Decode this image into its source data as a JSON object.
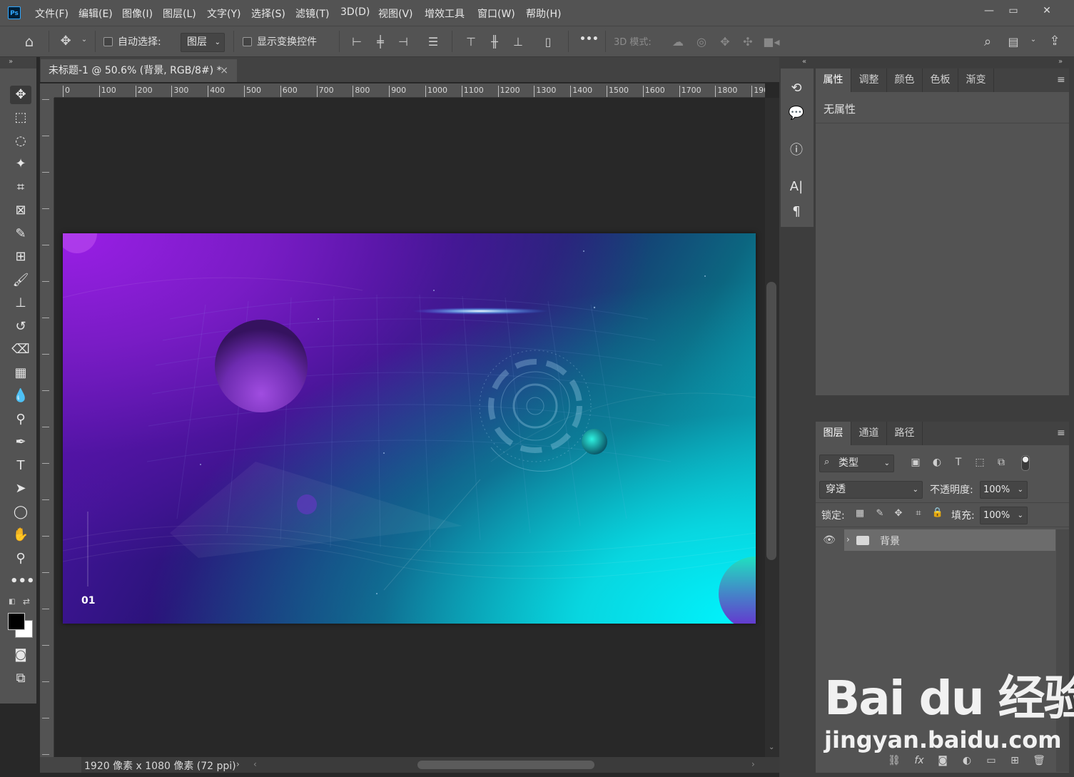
{
  "app": {
    "logo": "Ps"
  },
  "menu": [
    "文件(F)",
    "编辑(E)",
    "图像(I)",
    "图层(L)",
    "文字(Y)",
    "选择(S)",
    "滤镜(T)",
    "3D(D)",
    "视图(V)",
    "增效工具",
    "窗口(W)",
    "帮助(H)"
  ],
  "window_controls": {
    "minimize": "—",
    "restore": "▭",
    "close": "✕"
  },
  "options": {
    "auto_select_label": "自动选择:",
    "auto_select_target": "图层",
    "show_transform_label": "显示变换控件",
    "more": "•••",
    "mode_3d_label": "3D 模式:"
  },
  "document": {
    "tab_title": "未标题-1 @ 50.6% (背景, RGB/8#) *",
    "close": "×"
  },
  "ruler": {
    "h_labels": [
      "0",
      "100",
      "200",
      "300",
      "400",
      "500",
      "600",
      "700",
      "800",
      "900",
      "1000",
      "1100",
      "1200",
      "1300",
      "1400",
      "1500",
      "1600",
      "1700",
      "1800",
      "190"
    ]
  },
  "canvas": {
    "slide_number": "01"
  },
  "status": {
    "doc_size": "1920 像素 x 1080 像素 (72 ppi)"
  },
  "properties": {
    "tabs": [
      "属性",
      "调整",
      "颜色",
      "色板",
      "渐变"
    ],
    "active_tab": "属性",
    "empty_text": "无属性"
  },
  "layers": {
    "tabs": [
      "图层",
      "通道",
      "路径"
    ],
    "filter_kind": "类型",
    "blend_mode": "穿透",
    "opacity_label": "不透明度:",
    "opacity": "100%",
    "lock_label": "锁定:",
    "fill_label": "填充:",
    "fill": "100%",
    "items": [
      {
        "name": "背景",
        "type": "group",
        "visible": true
      }
    ]
  },
  "watermark": {
    "brand": "Bai du 经验",
    "url": "jingyan.baidu.com"
  },
  "colors": {
    "chrome": "#535353",
    "canvas_bg": "#282828",
    "accent": "#31a8ff"
  }
}
